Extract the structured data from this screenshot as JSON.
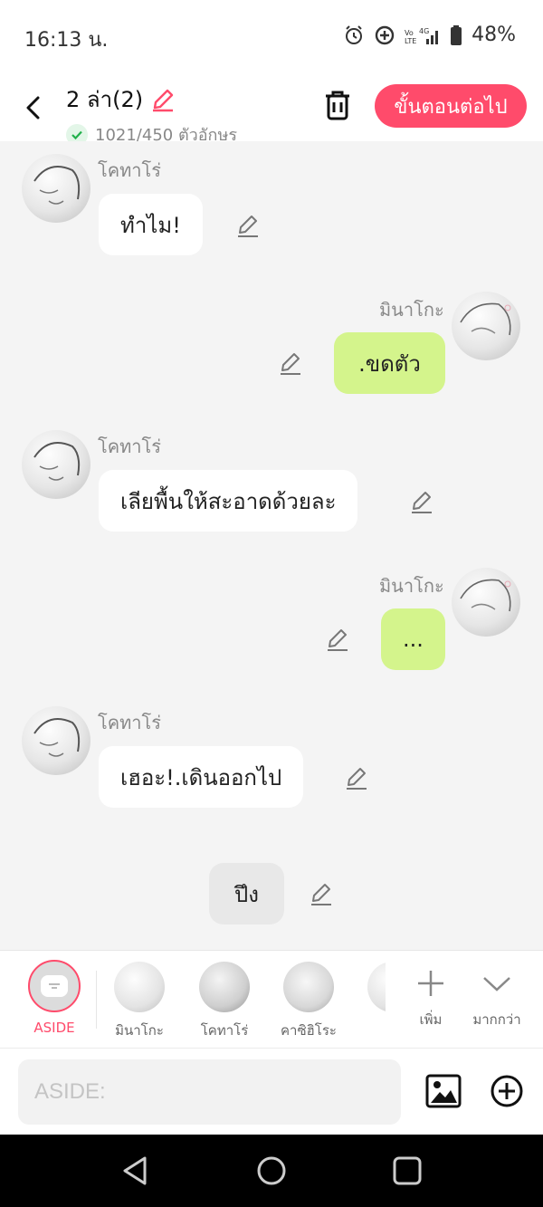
{
  "status_bar": {
    "time": "16:13 น.",
    "battery": "48%",
    "network": "4G"
  },
  "header": {
    "title": "2 ล่า(2)",
    "char_count": "1021/450 ตัวอักษร",
    "next_button": "ขั้นตอนต่อไป",
    "accent_color": "#ff4b6b"
  },
  "messages": [
    {
      "side": "left",
      "name": "โคทาโร่",
      "text": "ทำไม!"
    },
    {
      "side": "right",
      "name": "มินาโกะ",
      "text": ".ขดตัว"
    },
    {
      "side": "left",
      "name": "โคทาโร่",
      "text": "เลียพื้นให้สะอาดด้วยละ"
    },
    {
      "side": "right",
      "name": "มินาโกะ",
      "text": "..."
    },
    {
      "side": "left",
      "name": "โคทาโร่",
      "text": "เฮอะ!.เดินออกไป"
    },
    {
      "side": "center",
      "name": "",
      "text": "ปึง"
    }
  ],
  "character_bar": {
    "aside_label": "ASIDE",
    "characters": [
      "มินาโกะ",
      "โคทาโร่",
      "คาซิฮิโระ"
    ],
    "add_label": "เพิ่ม",
    "more_label": "มากกว่า"
  },
  "input": {
    "placeholder": "ASIDE:",
    "value": ""
  },
  "icons": [
    "back-icon",
    "pencil-icon",
    "trash-icon",
    "check-icon",
    "image-icon",
    "add-circle-icon",
    "plus-icon",
    "chevron-down-icon"
  ]
}
